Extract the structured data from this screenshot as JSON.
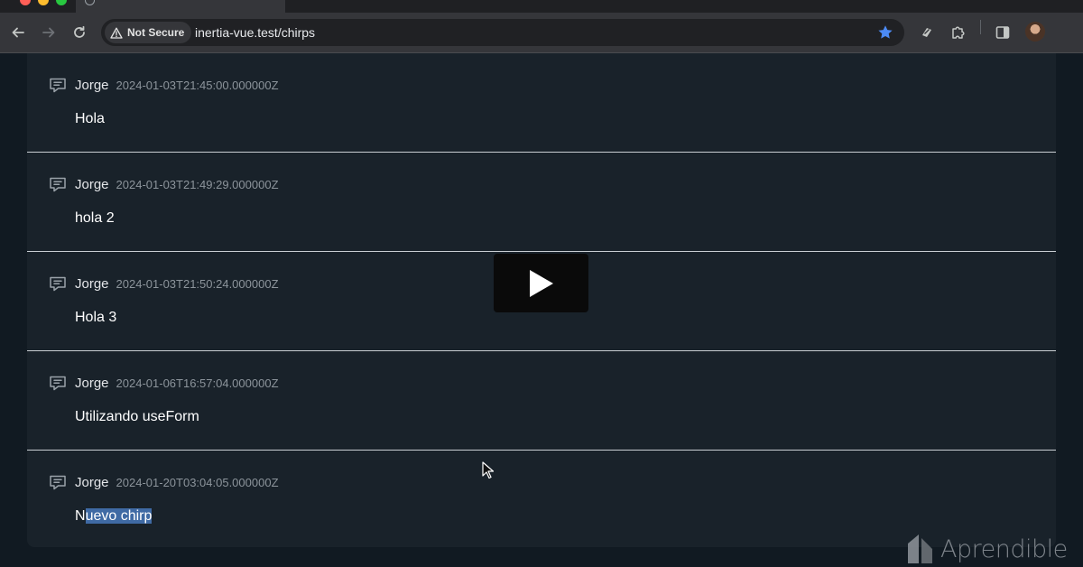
{
  "browser": {
    "security_label": "Not Secure",
    "url": "inertia-vue.test/chirps",
    "star_color": "#4c8bf5"
  },
  "chirps": [
    {
      "author": "Jorge",
      "date": "2024-01-03T21:45:00.000000Z",
      "message": "Hola"
    },
    {
      "author": "Jorge",
      "date": "2024-01-03T21:49:29.000000Z",
      "message": "hola 2"
    },
    {
      "author": "Jorge",
      "date": "2024-01-03T21:50:24.000000Z",
      "message": "Hola 3"
    },
    {
      "author": "Jorge",
      "date": "2024-01-06T16:57:04.000000Z",
      "message": "Utilizando useForm"
    },
    {
      "author": "Jorge",
      "date": "2024-01-20T03:04:05.000000Z",
      "message_plain": "N",
      "message_selected": "uevo chirp"
    }
  ],
  "watermark": {
    "text": "Aprendible"
  },
  "icons": {
    "chirp": "chat-bubble-icon",
    "play": "play-icon"
  }
}
